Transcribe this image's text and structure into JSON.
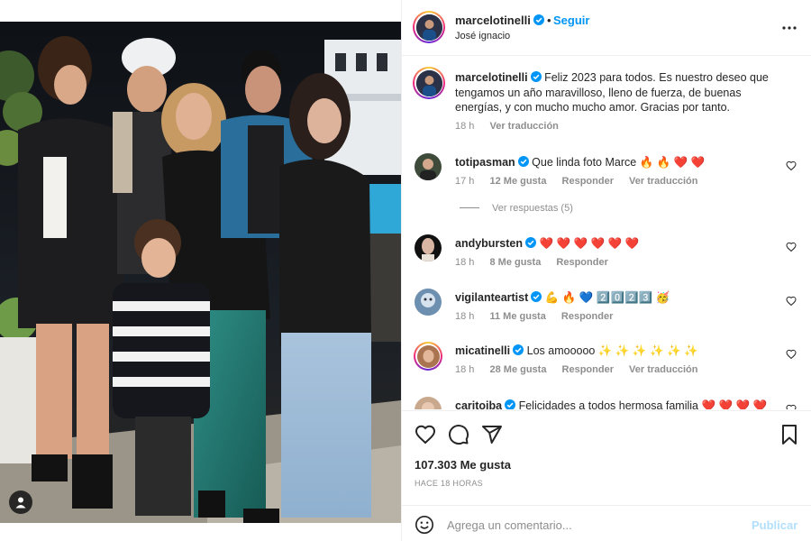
{
  "post": {
    "author": "marcelotinelli",
    "follow_label": "Seguir",
    "separator": "•",
    "location": "José ignacio",
    "likes": "107.303 Me gusta",
    "time_ago": "HACE 18 HORAS"
  },
  "caption": {
    "username": "marcelotinelli",
    "text": "Feliz 2023 para todos. Es nuestro deseo que tengamos un año maravilloso, lleno de fuerza, de buenas energías, y con mucho mucho amor. Gracias por tanto.",
    "time": "18 h",
    "translate": "Ver traducción"
  },
  "comments": [
    {
      "username": "totipasman",
      "text": "Que linda foto Marce 🔥 🔥 ❤️ ❤️",
      "time": "17 h",
      "likes": "12 Me gusta",
      "reply": "Responder",
      "translate": "Ver traducción",
      "view_replies": "Ver respuestas (5)"
    },
    {
      "username": "andybursten",
      "text": "❤️ ❤️ ❤️ ❤️ ❤️ ❤️",
      "time": "18 h",
      "likes": "8 Me gusta",
      "reply": "Responder"
    },
    {
      "username": "vigilanteartist",
      "text": "💪 🔥 💙 2️⃣0️⃣2️⃣3️⃣ 🥳",
      "time": "18 h",
      "likes": "11 Me gusta",
      "reply": "Responder"
    },
    {
      "username": "micatinelli",
      "text": "Los amooooo ✨ ✨ ✨ ✨ ✨ ✨",
      "time": "18 h",
      "likes": "28 Me gusta",
      "reply": "Responder",
      "translate": "Ver traducción"
    },
    {
      "username": "caritoiba",
      "text": "Felicidades a todos hermosa familia ❤️ ❤️ ❤️ ❤️"
    }
  ],
  "comment_box": {
    "placeholder": "Agrega un comentario...",
    "publish_label": "Publicar"
  },
  "colors": {
    "link_blue": "#0095f6",
    "publish_disabled": "#b2dffc",
    "muted_text": "#8e8e8e",
    "verified": "#0095f6"
  },
  "icons": [
    "verified-icon",
    "more-options-icon",
    "heart-icon",
    "comment-icon",
    "share-icon",
    "save-icon",
    "emoji-icon",
    "user-tag-icon"
  ]
}
